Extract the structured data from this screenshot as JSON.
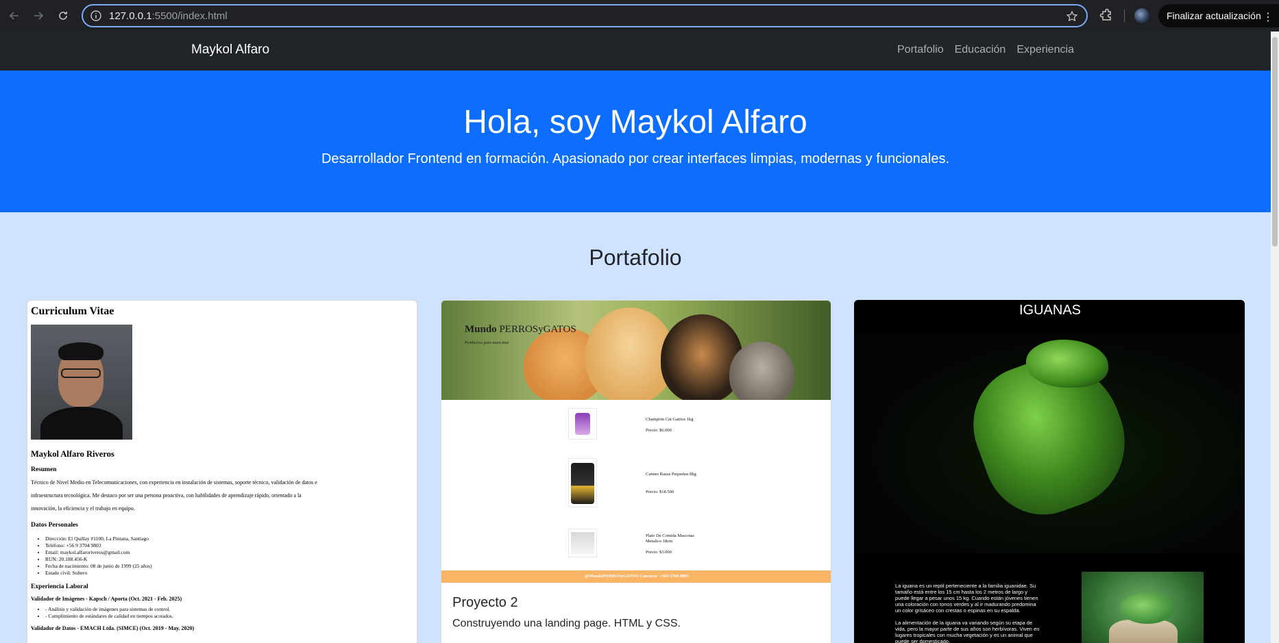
{
  "browser": {
    "url_host": "127.0.0.1",
    "url_rest": ":5500/index.html",
    "update_button": "Finalizar actualización"
  },
  "nav": {
    "brand": "Maykol Alfaro",
    "links": [
      "Portafolio",
      "Educación",
      "Experiencia"
    ]
  },
  "hero": {
    "title": "Hola, soy Maykol Alfaro",
    "subtitle": "Desarrollador Frontend en formación. Apasionado por crear interfaces limpias, modernas y funcionales."
  },
  "portfolio": {
    "title": "Portafolio",
    "cv": {
      "title": "Curriculum Vitae",
      "name": "Maykol Alfaro Riveros",
      "summary_heading": "Resumen",
      "summary": "Técnico de Nivel Medio en Telecomunicaciones, con experiencia en instalación de sistemas, soporte técnico, validación de datos e infraestructura tecnológica. Me destaco por ser una persona proactiva, con habilidades de aprendizaje rápido, orientado a la innovación, la eficiencia y el trabajo en equipo.",
      "personal_heading": "Datos Personales",
      "personal": [
        "Dirección: El Quillay #1100, La Pintana, Santiago",
        "Teléfono: +56 9 3704 9803",
        "Email: maykol.alfaroriveros@gmail.com",
        "RUN: 20.188.456-K",
        "Fecha de nacimiento: 08 de junio de 1999 (25 años)",
        "Estado civil: Soltero"
      ],
      "experience_heading": "Experiencia Laboral",
      "job1_title": "Validador de Imágenes - Kapsch / Aporta (Oct. 2021 - Feb. 2025)",
      "job1_items": [
        "- Análisis y validación de imágenes para sistemas de control.",
        "- Cumplimiento de estándares de calidad en tiempos acotados."
      ],
      "job2_title": "Validador de Datos - EMACH Ltda. (SIMCE) (Oct. 2019 - May. 2020)"
    },
    "landing": {
      "brand_bold": "Mundo",
      "brand_rest": " PERROSyGATOS",
      "tagline": "Productos para mascotas",
      "products": [
        {
          "name": "Champion Cat Gatitos 1kg",
          "price": "Precio: $6.000"
        },
        {
          "name": "Cannes Razas Pequeñas 8kg",
          "price": "Precio: $18.500"
        },
        {
          "name": "Plato De Comida Mascotas Metalico 18cm",
          "price": "Precio: $3.000"
        }
      ],
      "footer": "@MundoPERROSyGATOS Contacto: +569 3704 9803",
      "card_title": "Proyecto 2",
      "card_text": "Construyendo una landing page. HTML y CSS."
    },
    "iguanas": {
      "title": "IGUANAS",
      "paragraphs": [
        "La iguana es un reptil perteneciente a la familia iguanidae. Su tamaño está entre los 15 cm hasta los 2 metros de largo y puede llegar a pesar unos 15 kg. Cuando están jóvenes tienen una coloración con tonos verdes y al ir madurando predomina un color grisáceo con crestas o espinas en su espalda.",
        "La alimentación de la iguana va variando según su etapa de vida, pero la mayor parte de sus años son herbívoras. Viven en lugares tropicales con mucha vegetación y es un animal que puede ser domesticado."
      ]
    }
  }
}
